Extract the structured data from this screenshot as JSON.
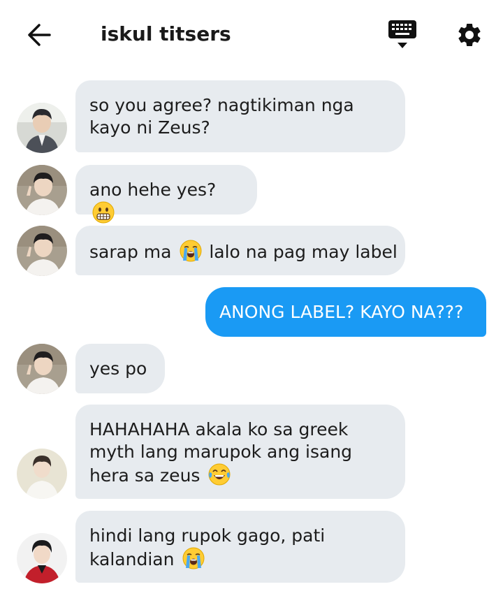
{
  "header": {
    "title": "iskul titsers",
    "back_icon": "arrow-left-icon",
    "keyboard_icon": "keyboard-icon",
    "settings_icon": "gear-icon"
  },
  "messages": [
    {
      "side": "in",
      "text_before": "so you agree? nagtikiman nga kayo ni Zeus?",
      "emoji": "",
      "text_after": ""
    },
    {
      "side": "in",
      "text_before": "ano hehe yes?",
      "emoji": "grimacing-face",
      "text_after": ""
    },
    {
      "side": "in",
      "text_before": "sarap ma",
      "emoji": "loudly-crying-face",
      "text_after": "lalo na pag may label"
    },
    {
      "side": "out",
      "text_before": "ANONG LABEL? KAYO NA???",
      "emoji": "",
      "text_after": ""
    },
    {
      "side": "in",
      "text_before": "yes po",
      "emoji": "",
      "text_after": ""
    },
    {
      "side": "in",
      "text_before": "HAHAHAHA akala ko sa greek myth lang marupok ang isang hera sa zeus",
      "emoji": "face-with-tears-of-joy",
      "text_after": ""
    },
    {
      "side": "in",
      "text_before": "hindi lang rupok gago, pati kalandian",
      "emoji": "loudly-crying-face",
      "text_after": ""
    }
  ],
  "colors": {
    "incoming_bubble": "#e7ebef",
    "outgoing_bubble": "#1a9af4",
    "outgoing_text": "#ffffff"
  }
}
